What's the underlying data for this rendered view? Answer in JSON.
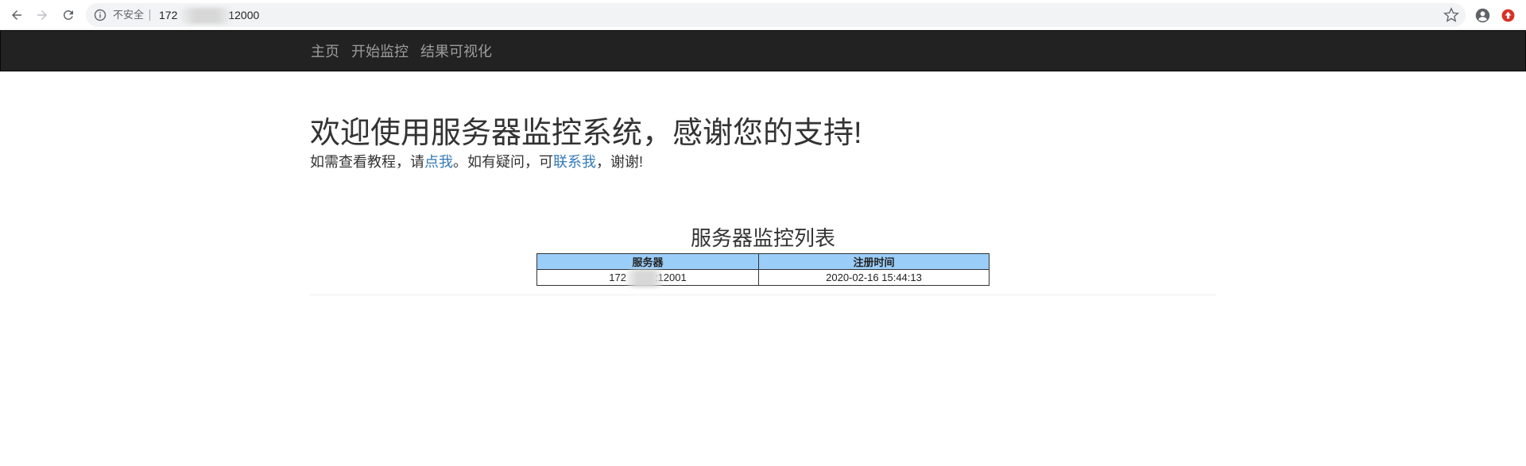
{
  "browser": {
    "security_label": "不安全",
    "url_prefix": "172",
    "url_suffix": "12000",
    "icons": [
      "back-arrow-icon",
      "forward-arrow-icon",
      "reload-icon",
      "info-icon",
      "star-icon",
      "account-icon",
      "extension-icon"
    ]
  },
  "navbar": {
    "items": [
      {
        "label": "主页"
      },
      {
        "label": "开始监控"
      },
      {
        "label": "结果可视化"
      }
    ]
  },
  "main": {
    "headline": "欢迎使用服务器监控系统，感谢您的支持!",
    "subline": {
      "part1": "如需查看教程，请",
      "link1": "点我",
      "part2": "。如有疑问，可",
      "link2": "联系我",
      "part3": "，谢谢!"
    },
    "table": {
      "title": "服务器监控列表",
      "headers": [
        "服务器",
        "注册时间"
      ],
      "rows": [
        {
          "server_prefix": "172",
          "server_suffix": ":12001",
          "time": "2020-02-16 15:44:13"
        }
      ]
    }
  },
  "colors": {
    "navbar_bg": "#222222",
    "nav_link": "#9d9d9d",
    "link": "#337ab7",
    "table_header_bg": "#9acdf8"
  }
}
